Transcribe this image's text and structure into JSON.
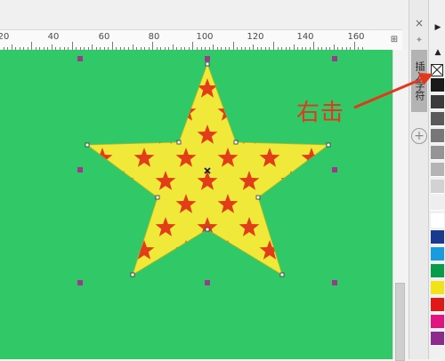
{
  "ruler": {
    "labels": [
      "20",
      "40",
      "60",
      "80",
      "100",
      "120",
      "140",
      "160"
    ],
    "tool_glyph": "⊞"
  },
  "docker": {
    "close_glyph": "×",
    "pin_glyph": "✦",
    "star_glyph": "★",
    "tab_label": "插入字符",
    "add_glyph": "+"
  },
  "palette": {
    "arrow_right": "▶",
    "arrow_up": "▲",
    "swatches": [
      "#1a1a1a",
      "#3b3b3b",
      "#5a5a5a",
      "#777777",
      "#959595",
      "#b4b4b4",
      "#d2d2d2",
      "#eeeeee",
      "#ffffff",
      "#1b3a8f",
      "#1a9be0",
      "#0a9b4a",
      "#f0e31a",
      "#e01818",
      "#e0157f",
      "#8c2b8c"
    ],
    "no_color_label": "No color"
  },
  "annotation": {
    "text": "右击",
    "color": "#e2391c"
  },
  "canvas": {
    "background": "#31c868",
    "star_fill": "#f1e93a",
    "pattern_star_color": "#e03d18"
  }
}
